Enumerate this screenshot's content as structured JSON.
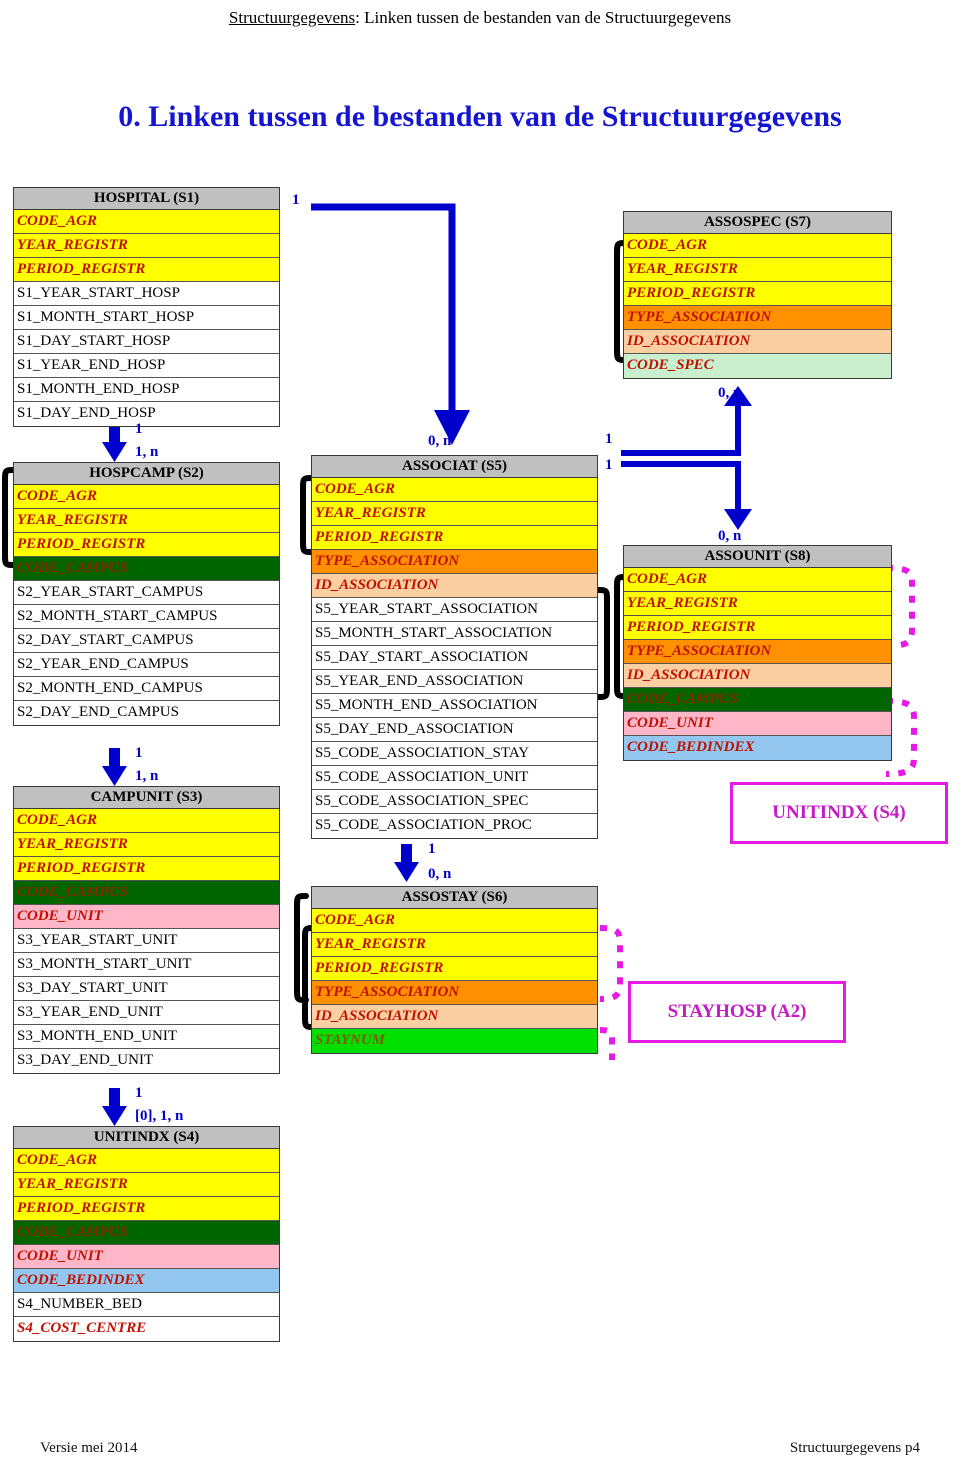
{
  "header": {
    "prefix": "Structuurgegevens",
    "rest": ": Linken tussen de bestanden van de Structuurgegevens"
  },
  "title": "0. Linken tussen de bestanden van de Structuurgegevens",
  "footer": {
    "left": "Versie mei 2014",
    "right": "Structuurgegevens p4"
  },
  "colors": {
    "key_yellow": "#ffff00",
    "campus_green": "#006400",
    "unit_pink": "#ffb6c8",
    "bedindex_blue": "#93c7f0",
    "type_orange": "#ff9000",
    "id_peach": "#fbcfa2",
    "spec_mint": "#c9efcf",
    "staynum_green": "#00e000",
    "header_grey": "#c0c0c0",
    "arrow_blue": "#0000cd",
    "ref_magenta": "#e619e6",
    "title_blue": "#1414d2",
    "field_red": "#c01000"
  },
  "tables": [
    {
      "id": "s1",
      "title": "HOSPITAL (S1)",
      "fields": [
        {
          "label": "CODE_AGR",
          "style": "k yellow"
        },
        {
          "label": "YEAR_REGISTR",
          "style": "k yellow"
        },
        {
          "label": "PERIOD_REGISTR",
          "style": "k yellow"
        },
        {
          "label": "S1_YEAR_START_HOSP",
          "style": "plain"
        },
        {
          "label": "S1_MONTH_START_HOSP",
          "style": "plain"
        },
        {
          "label": "S1_DAY_START_HOSP",
          "style": "plain"
        },
        {
          "label": "S1_YEAR_END_HOSP",
          "style": "plain"
        },
        {
          "label": "S1_MONTH_END_HOSP",
          "style": "plain"
        },
        {
          "label": "S1_DAY_END_HOSP",
          "style": "plain"
        }
      ]
    },
    {
      "id": "s2",
      "title": "HOSPCAMP (S2)",
      "fields": [
        {
          "label": "CODE_AGR",
          "style": "k yellow"
        },
        {
          "label": "YEAR_REGISTR",
          "style": "k yellow"
        },
        {
          "label": "PERIOD_REGISTR",
          "style": "k yellow"
        },
        {
          "label": "CODE_CAMPUS",
          "style": "k green"
        },
        {
          "label": "S2_YEAR_START_CAMPUS",
          "style": "plain"
        },
        {
          "label": "S2_MONTH_START_CAMPUS",
          "style": "plain"
        },
        {
          "label": "S2_DAY_START_CAMPUS",
          "style": "plain"
        },
        {
          "label": "S2_YEAR_END_CAMPUS",
          "style": "plain"
        },
        {
          "label": "S2_MONTH_END_CAMPUS",
          "style": "plain"
        },
        {
          "label": "S2_DAY_END_CAMPUS",
          "style": "plain"
        }
      ]
    },
    {
      "id": "s3",
      "title": "CAMPUNIT (S3)",
      "fields": [
        {
          "label": "CODE_AGR",
          "style": "k yellow"
        },
        {
          "label": "YEAR_REGISTR",
          "style": "k yellow"
        },
        {
          "label": "PERIOD_REGISTR",
          "style": "k yellow"
        },
        {
          "label": "CODE_CAMPUS",
          "style": "k green"
        },
        {
          "label": "CODE_UNIT",
          "style": "k pink"
        },
        {
          "label": "S3_YEAR_START_UNIT",
          "style": "plain"
        },
        {
          "label": "S3_MONTH_START_UNIT",
          "style": "plain"
        },
        {
          "label": "S3_DAY_START_UNIT",
          "style": "plain"
        },
        {
          "label": "S3_YEAR_END_UNIT",
          "style": "plain"
        },
        {
          "label": "S3_MONTH_END_UNIT",
          "style": "plain"
        },
        {
          "label": "S3_DAY_END_UNIT",
          "style": "plain"
        }
      ]
    },
    {
      "id": "s4",
      "title": "UNITINDX (S4)",
      "fields": [
        {
          "label": "CODE_AGR",
          "style": "k yellow"
        },
        {
          "label": "YEAR_REGISTR",
          "style": "k yellow"
        },
        {
          "label": "PERIOD_REGISTR",
          "style": "k yellow"
        },
        {
          "label": "CODE_CAMPUS",
          "style": "k green"
        },
        {
          "label": "CODE_UNIT",
          "style": "k pink"
        },
        {
          "label": "CODE_BEDINDEX",
          "style": "k blue"
        },
        {
          "label": "S4_NUMBER_BED",
          "style": "plain"
        },
        {
          "label": "S4_COST_CENTRE",
          "style": "red-it"
        }
      ]
    },
    {
      "id": "s5",
      "title": "ASSOCIAT (S5)",
      "fields": [
        {
          "label": "CODE_AGR",
          "style": "k yellow"
        },
        {
          "label": "YEAR_REGISTR",
          "style": "k yellow"
        },
        {
          "label": "PERIOD_REGISTR",
          "style": "k yellow"
        },
        {
          "label": "TYPE_ASSOCIATION",
          "style": "k orange"
        },
        {
          "label": "ID_ASSOCIATION",
          "style": "k peach"
        },
        {
          "label": "S5_YEAR_START_ASSOCIATION",
          "style": "plain"
        },
        {
          "label": "S5_MONTH_START_ASSOCIATION",
          "style": "plain"
        },
        {
          "label": "S5_DAY_START_ASSOCIATION",
          "style": "plain"
        },
        {
          "label": "S5_YEAR_END_ASSOCIATION",
          "style": "plain"
        },
        {
          "label": "S5_MONTH_END_ASSOCIATION",
          "style": "plain"
        },
        {
          "label": "S5_DAY_END_ASSOCIATION",
          "style": "plain"
        },
        {
          "label": "S5_CODE_ASSOCIATION_STAY",
          "style": "plain"
        },
        {
          "label": "S5_CODE_ASSOCIATION_UNIT",
          "style": "plain"
        },
        {
          "label": "S5_CODE_ASSOCIATION_SPEC",
          "style": "plain"
        },
        {
          "label": "S5_CODE_ASSOCIATION_PROC",
          "style": "plain"
        }
      ]
    },
    {
      "id": "s6",
      "title": "ASSOSTAY (S6)",
      "fields": [
        {
          "label": "CODE_AGR",
          "style": "k yellow"
        },
        {
          "label": "YEAR_REGISTR",
          "style": "k yellow"
        },
        {
          "label": "PERIOD_REGISTR",
          "style": "k yellow"
        },
        {
          "label": "TYPE_ASSOCIATION",
          "style": "k orange"
        },
        {
          "label": "ID_ASSOCIATION",
          "style": "k peach"
        },
        {
          "label": "STAYNUM",
          "style": "k lgreen"
        }
      ]
    },
    {
      "id": "s7",
      "title": "ASSOSPEC (S7)",
      "fields": [
        {
          "label": "CODE_AGR",
          "style": "k yellow"
        },
        {
          "label": "YEAR_REGISTR",
          "style": "k yellow"
        },
        {
          "label": "PERIOD_REGISTR",
          "style": "k yellow"
        },
        {
          "label": "TYPE_ASSOCIATION",
          "style": "k orange"
        },
        {
          "label": "ID_ASSOCIATION",
          "style": "k peach"
        },
        {
          "label": "CODE_SPEC",
          "style": "k mint"
        }
      ]
    },
    {
      "id": "s8",
      "title": "ASSOUNIT (S8)",
      "fields": [
        {
          "label": "CODE_AGR",
          "style": "k yellow"
        },
        {
          "label": "YEAR_REGISTR",
          "style": "k yellow"
        },
        {
          "label": "PERIOD_REGISTR",
          "style": "k yellow"
        },
        {
          "label": "TYPE_ASSOCIATION",
          "style": "k orange"
        },
        {
          "label": "ID_ASSOCIATION",
          "style": "k peach"
        },
        {
          "label": "CODE_CAMPUS",
          "style": "k green"
        },
        {
          "label": "CODE_UNIT",
          "style": "k pink"
        },
        {
          "label": "CODE_BEDINDEX",
          "style": "k blue"
        }
      ]
    }
  ],
  "ref_boxes": [
    {
      "id": "ref-s4",
      "label": "UNITINDX (S4)"
    },
    {
      "id": "ref-a2",
      "label": "STAYHOSP (A2)"
    }
  ],
  "cardinalities": [
    {
      "id": "c-s1-top",
      "text": "1"
    },
    {
      "id": "c-s1-s2-one",
      "text": "1"
    },
    {
      "id": "c-s1-s2-many",
      "text": "1, n"
    },
    {
      "id": "c-s2-s3-one",
      "text": "1"
    },
    {
      "id": "c-s2-s3-many",
      "text": "1, n"
    },
    {
      "id": "c-s3-s4-one",
      "text": "1"
    },
    {
      "id": "c-s3-s4-many",
      "text": "[0], 1, n"
    },
    {
      "id": "c-s5-top",
      "text": "0, n"
    },
    {
      "id": "c-s5-right-1",
      "text": "1"
    },
    {
      "id": "c-s5-right-2",
      "text": "1"
    },
    {
      "id": "c-s7-bottom",
      "text": "0, n"
    },
    {
      "id": "c-s8-top",
      "text": "0, n"
    },
    {
      "id": "c-s5-s6-one",
      "text": "1"
    },
    {
      "id": "c-s5-s6-many",
      "text": "0, n"
    }
  ]
}
